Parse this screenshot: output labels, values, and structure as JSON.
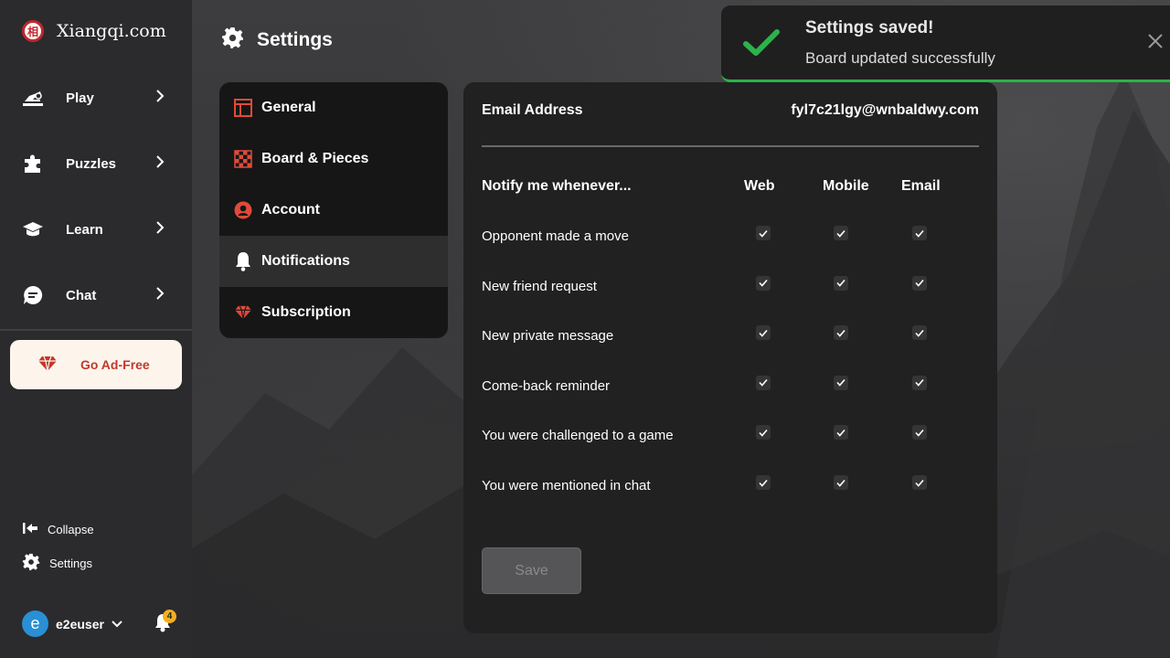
{
  "brand": {
    "name": "Xiangqi.com",
    "logo_char": "相"
  },
  "sidebar": {
    "nav": [
      {
        "label": "Play",
        "icon": "hand-piece-icon"
      },
      {
        "label": "Puzzles",
        "icon": "puzzle-icon"
      },
      {
        "label": "Learn",
        "icon": "graduation-cap-icon"
      },
      {
        "label": "Chat",
        "icon": "chat-bubble-icon"
      }
    ],
    "adfree_label": "Go Ad-Free",
    "collapse_label": "Collapse",
    "settings_label": "Settings",
    "user": {
      "initial": "e",
      "name": "e2euser"
    },
    "notifications_count": "4"
  },
  "header": {
    "title": "Settings"
  },
  "settings_menu": [
    {
      "label": "General",
      "icon": "window-icon"
    },
    {
      "label": "Board & Pieces",
      "icon": "checkerboard-icon"
    },
    {
      "label": "Account",
      "icon": "user-circle-icon"
    },
    {
      "label": "Notifications",
      "icon": "bell-icon",
      "active": true
    },
    {
      "label": "Subscription",
      "icon": "gem-icon"
    }
  ],
  "notifications": {
    "email_label": "Email Address",
    "email_value": "fyl7c21lgy@wnbaldwy.com",
    "heading": "Notify me whenever...",
    "columns": [
      "Web",
      "Mobile",
      "Email"
    ],
    "rows": [
      {
        "label": "Opponent made a move",
        "web": true,
        "mobile": true,
        "email": true
      },
      {
        "label": "New friend request",
        "web": true,
        "mobile": true,
        "email": true
      },
      {
        "label": "New private message",
        "web": true,
        "mobile": true,
        "email": true
      },
      {
        "label": "Come-back reminder",
        "web": true,
        "mobile": true,
        "email": true
      },
      {
        "label": "You were challenged to a game",
        "web": true,
        "mobile": true,
        "email": true
      },
      {
        "label": "You were mentioned in chat",
        "web": true,
        "mobile": true,
        "email": true
      }
    ],
    "save_label": "Save"
  },
  "toast": {
    "title": "Settings saved!",
    "message": "Board updated successfully"
  },
  "colors": {
    "accent_red": "#c0392b",
    "success_green": "#2bb34a",
    "badge_yellow": "#f2b01e"
  }
}
